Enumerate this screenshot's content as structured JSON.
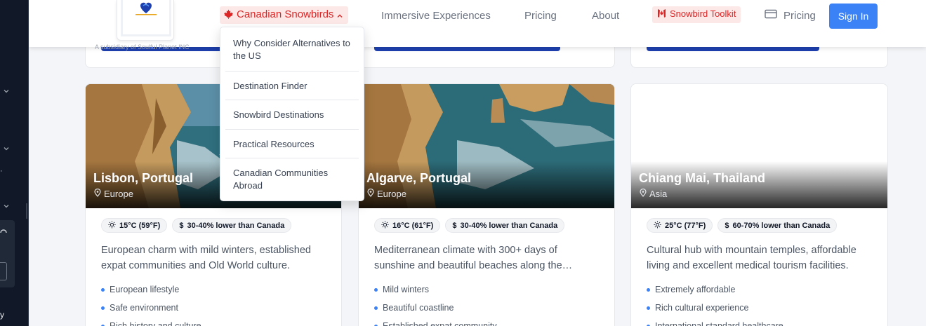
{
  "header": {
    "logo_subtitle": "A subsidiary of Soulful Planet INC",
    "nav": {
      "canadian_snowbirds": "Canadian Snowbirds",
      "immersive": "Immersive Experiences",
      "pricing": "Pricing",
      "about": "About",
      "toolkit": "Snowbird Toolkit",
      "pricing2": "Pricing",
      "sign_in": "Sign In"
    }
  },
  "dropdown": {
    "items": [
      "Why Consider Alternatives to the US",
      "Destination Finder",
      "Snowbird Destinations",
      "Practical Resources",
      "Canadian Communities Abroad"
    ]
  },
  "sidebar": {
    "partial_text": "y"
  },
  "cards": [
    {
      "title": "Lisbon, Portugal",
      "region": "Europe",
      "temp": "15°C (59°F)",
      "cost": "30-40% lower than Canada",
      "description": "European charm with mild winters, established expat communities and Old World culture.",
      "features": [
        "European lifestyle",
        "Safe environment",
        "Rich history and culture"
      ]
    },
    {
      "title": "Algarve, Portugal",
      "region": "Europe",
      "temp": "16°C (61°F)",
      "cost": "30-40% lower than Canada",
      "description": "Mediterranean climate with 300+ days of sunshine and beautiful beaches along the…",
      "features": [
        "Mild winters",
        "Beautiful coastline",
        "Established expat community"
      ]
    },
    {
      "title": "Chiang Mai, Thailand",
      "region": "Asia",
      "temp": "25°C (77°F)",
      "cost": "60-70% lower than Canada",
      "description": "Cultural hub with mountain temples, affordable living and excellent medical tourism facilities.",
      "features": [
        "Extremely affordable",
        "Rich cultural experience",
        "International standard healthcare"
      ]
    }
  ],
  "colors": {
    "accent_red": "#dc2626",
    "primary_blue": "#3b82f6",
    "dark_blue": "#1e40af",
    "sidebar_dark": "#111827"
  }
}
